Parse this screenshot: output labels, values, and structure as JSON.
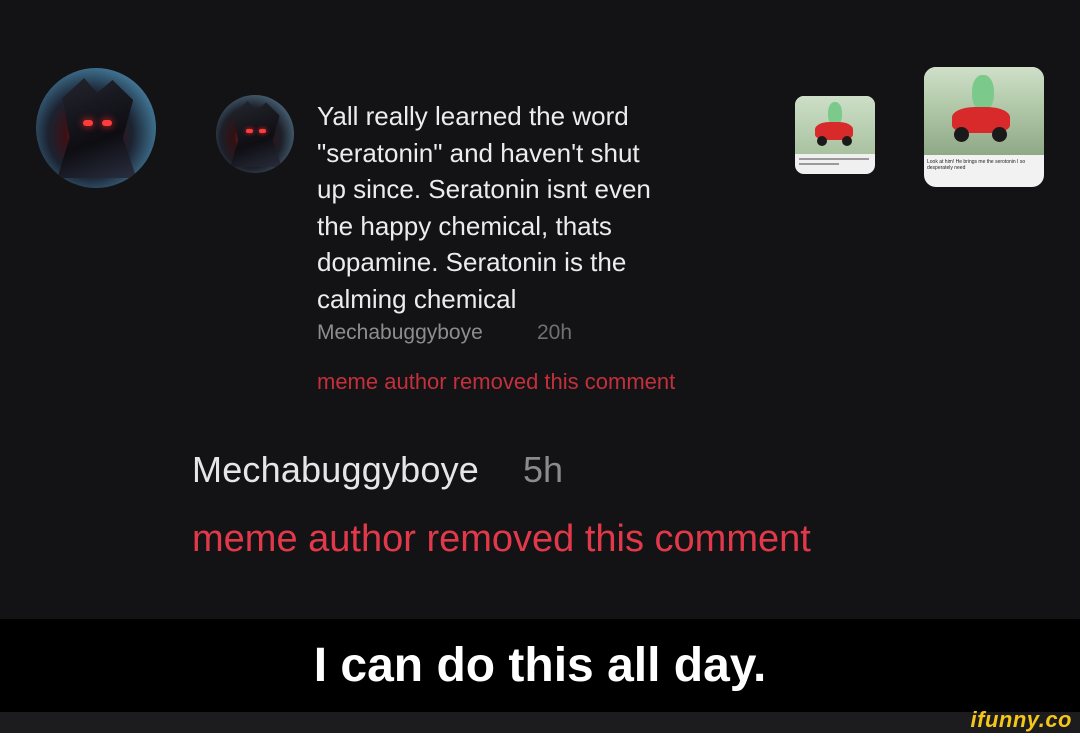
{
  "original_comment": {
    "text_lines": [
      "Yall really learned the word",
      "\"seratonin\" and haven't shut",
      "up since. Seratonin isnt even",
      "the happy chemical, thats",
      "dopamine. Seratonin is the",
      "calming chemical"
    ],
    "reply_author": "Mechabuggyboye",
    "reply_time": "20h",
    "reply_removed": "meme author removed this comment"
  },
  "outer_reply": {
    "author": "Mechabuggyboye",
    "time": "5h",
    "removed": "meme author removed this comment"
  },
  "outer_thumb_caption": "Look at him! He brings me the serotonin I so desperately need",
  "caption": "I can do this all day.",
  "watermark": "ifunny.co",
  "colors": {
    "background": "#131315",
    "removed_text": "#e2394a",
    "watermark": "#f5c518"
  },
  "icons": {
    "avatar": "armored-red-eyed-character-avatar",
    "meme_thumbnail": "green-toy-on-red-scooter-thumbnail"
  }
}
